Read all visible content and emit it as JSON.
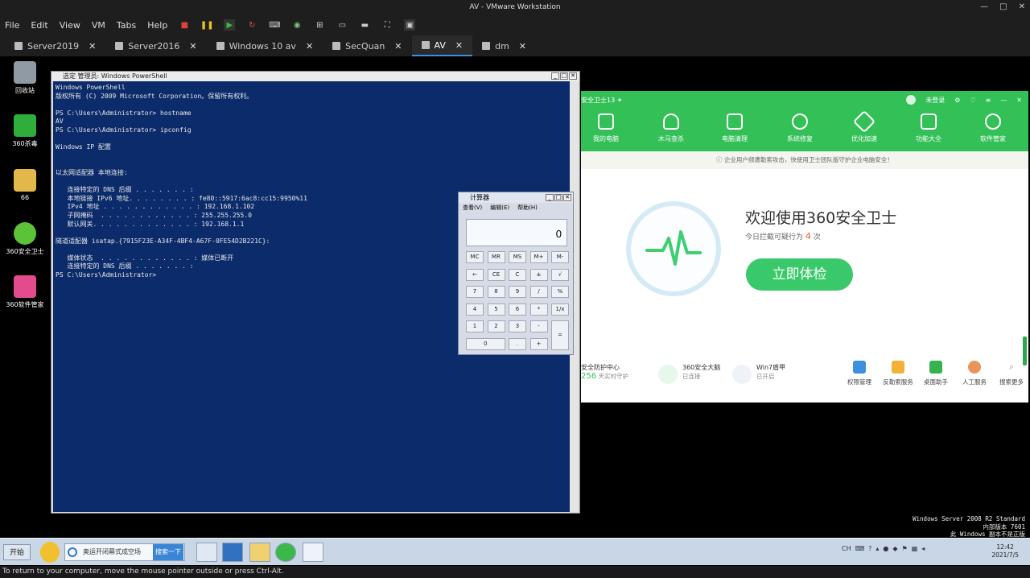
{
  "window_title": "AV - VMware Workstation",
  "menu": [
    "File",
    "Edit",
    "View",
    "VM",
    "Tabs",
    "Help"
  ],
  "vm_tabs": [
    {
      "label": "Server2019"
    },
    {
      "label": "Server2016"
    },
    {
      "label": "Windows 10 av"
    },
    {
      "label": "SecQuan"
    },
    {
      "label": "AV",
      "active": true
    },
    {
      "label": "dm"
    }
  ],
  "desktop_icons": [
    {
      "label": "回收站",
      "icon": "recycle-bin-icon",
      "color": "#8f9aa4"
    },
    {
      "label": "360杀毒",
      "icon": "360-antivirus-icon",
      "color": "#2fae3c"
    },
    {
      "label": "66",
      "icon": "folder-icon",
      "color": "#e3b84a"
    },
    {
      "label": "360安全卫士",
      "icon": "360-security-icon",
      "color": "#5cc23a"
    },
    {
      "label": "360软件管家",
      "icon": "360-software-icon",
      "color": "#e34b8c"
    }
  ],
  "powershell": {
    "title": "选定 管理员: Windows PowerShell",
    "lines": [
      "Windows PowerShell",
      "版权所有 (C) 2009 Microsoft Corporation。保留所有权利。",
      "",
      "PS C:\\Users\\Administrator> hostname",
      "AV",
      "PS C:\\Users\\Administrator> ipconfig",
      "",
      "Windows IP 配置",
      "",
      "",
      "以太网适配器 本地连接:",
      "",
      "   连接特定的 DNS 后缀 . . . . . . . :",
      "   本地链接 IPv6 地址. . . . . . . . : fe80::5917:6ac8:cc15:9950%11",
      "   IPv4 地址 . . . . . . . . . . . . : 192.168.1.102",
      "   子网掩码  . . . . . . . . . . . . : 255.255.255.0",
      "   默认网关. . . . . . . . . . . . . : 192.168.1.1",
      "",
      "隧道适配器 isatap.{7915F23E-A34F-4BF4-A67F-0FE54D2B221C}:",
      "",
      "   媒体状态  . . . . . . . . . . . . : 媒体已断开",
      "   连接特定的 DNS 后缀 . . . . . . . :",
      "PS C:\\Users\\Administrator>"
    ]
  },
  "calculator": {
    "title": "计算器",
    "menu": [
      "查看(V)",
      "编辑(E)",
      "帮助(H)"
    ],
    "display": "0",
    "rows": [
      [
        "MC",
        "MR",
        "MS",
        "M+",
        "M-"
      ],
      [
        "←",
        "CE",
        "C",
        "±",
        "√"
      ],
      [
        "7",
        "8",
        "9",
        "/",
        "%"
      ],
      [
        "4",
        "5",
        "6",
        "*",
        "1/x"
      ],
      [
        "1",
        "2",
        "3",
        "-",
        "="
      ],
      [
        "0",
        ".",
        "+"
      ]
    ]
  },
  "w360": {
    "title": "安全卫士13",
    "login": "未登录",
    "nav": [
      "我的电脑",
      "木马查杀",
      "电脑清理",
      "系统修复",
      "优化加速",
      "功能大全",
      "软件管家"
    ],
    "notice": "企业用户频遭勒索攻击，快使用卫士团队版守护企业电脑安全！",
    "welcome": "欢迎使用360安全卫士",
    "blocked_prefix": "今日拦截可疑行为",
    "blocked_count": "4",
    "blocked_suffix": "次",
    "check_button": "立即体检",
    "bottom_items": [
      {
        "title": "安全防护中心",
        "value": "256",
        "sub": "天实时守护"
      },
      {
        "title": "360安全大脑",
        "sub": "已连接"
      },
      {
        "title": "Win7盾甲",
        "sub": "已开启"
      }
    ],
    "tools": [
      {
        "label": "权限管理",
        "color": "#3d8fe0"
      },
      {
        "label": "反勒索服务",
        "color": "#f2b23a"
      },
      {
        "label": "桌面助手",
        "color": "#37b24d"
      },
      {
        "label": "人工服务",
        "color": "#e8955a"
      },
      {
        "label": "搜索更多",
        "color": "#cccccc"
      }
    ],
    "accent": "#33c057"
  },
  "watermark": [
    "Windows Server 2008 R2 Standard",
    "内部版本 7601",
    "此 Windows 副本不是正版"
  ],
  "taskbar": {
    "start": "开始",
    "search_text": "奥运开闭幕式成空场",
    "search_button": "搜索一下",
    "time": "12:42",
    "date": "2021/7/5"
  },
  "status_text": "To return to your computer, move the mouse pointer outside or press Ctrl-Alt."
}
